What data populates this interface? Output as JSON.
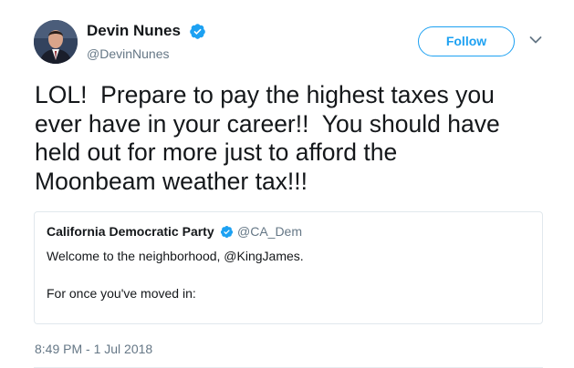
{
  "author": {
    "name": "Devin Nunes",
    "handle": "@DevinNunes",
    "verified": true,
    "avatar_icon": "profile-photo"
  },
  "actions": {
    "follow_label": "Follow",
    "more_icon": "chevron-down-icon"
  },
  "tweet": {
    "text": "LOL!  Prepare to pay the highest taxes you\never have in your career!!  You should have\nheld out for more just to afford the\nMoonbeam weather tax!!!",
    "timestamp": "8:49 PM - 1 Jul 2018"
  },
  "quoted_tweet": {
    "name": "California Democratic Party",
    "handle": "@CA_Dem",
    "verified": true,
    "line1": "Welcome to the neighborhood, @KingJames.",
    "line2": "For once you've moved in:"
  },
  "colors": {
    "accent": "#1da1f2",
    "text": "#14171a",
    "secondary": "#657786",
    "border": "#e1e8ed"
  }
}
